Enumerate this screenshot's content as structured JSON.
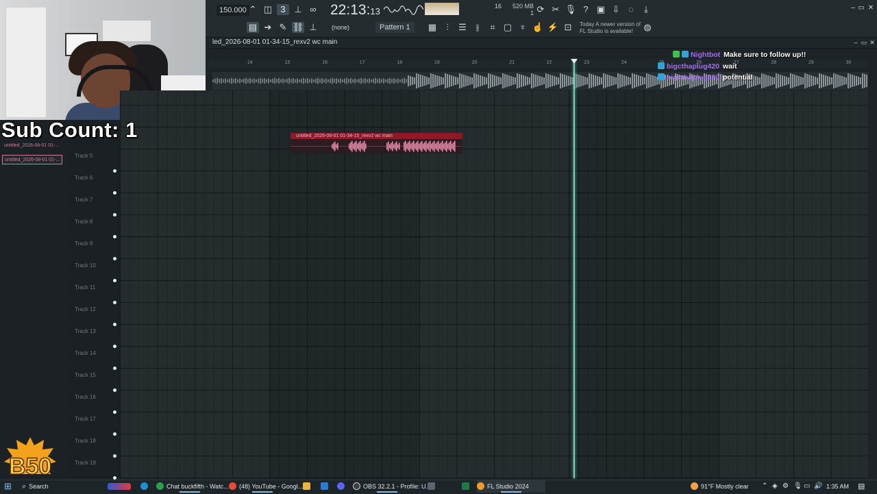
{
  "overlay": {
    "sub_count": "Sub Count: 1",
    "logo_text": "B50"
  },
  "toolbar": {
    "tempo": "150.000",
    "time_main": "22:13",
    "time_sub": "13",
    "memory_line1": "520 MB",
    "memory_line2": "1",
    "cpu_value": "16",
    "none_label": "(none)",
    "pattern_label": "Pattern 1",
    "news_line1": "Today  A newer version of",
    "news_line2": "FL Studio is available!"
  },
  "playlist": {
    "title": "led_2026-08-01 01-34-15_rexv2 wc main",
    "ruler_ticks": [
      "14",
      "15",
      "16",
      "17",
      "18",
      "19",
      "20",
      "21",
      "22",
      "23",
      "24",
      "25",
      "26",
      "27",
      "28",
      "29",
      "30"
    ],
    "tracks": [
      "Track 5",
      "Track 6",
      "Track 7",
      "Track 8",
      "Track 9",
      "Track 10",
      "Track 11",
      "Track 12",
      "Track 13",
      "Track 14",
      "Track 15",
      "Track 16",
      "Track 17",
      "Track 18",
      "Track 19"
    ],
    "clip_label": "untitled_2026-08-01 01-34-15_rexv2 wc main",
    "picker_items": [
      "untitled_2026-08-01 01-...",
      "untitled_2026-08-01 01-..."
    ]
  },
  "chat": [
    {
      "user": "Nightbot",
      "message": "Make sure to follow up!!",
      "user_color": "#a56cf2",
      "badge_color": "#3ec14a"
    },
    {
      "user": "bigcthaplug420",
      "message": "wait",
      "user_color": "#a56cf2",
      "badge_color": "#2ea3d8"
    },
    {
      "user": "bigcthaplug420",
      "message": "potential",
      "user_color": "#a56cf2",
      "badge_color": "#2ea3d8"
    }
  ],
  "taskbar": {
    "search_label": "Search",
    "items": [
      {
        "label": "Chat buckfifth - Watc...",
        "color": "#27a14a"
      },
      {
        "label": "(48) YouTube - Googl...",
        "color": "#e84b3a"
      },
      {
        "label": "OBS 32.2.1 - Profile: U...",
        "color": "#3b3f44"
      },
      {
        "label": "FL Studio 2024",
        "color": "#f29a2e"
      }
    ],
    "weather": "91°F  Mostly clear",
    "clock": "1:35 AM"
  }
}
